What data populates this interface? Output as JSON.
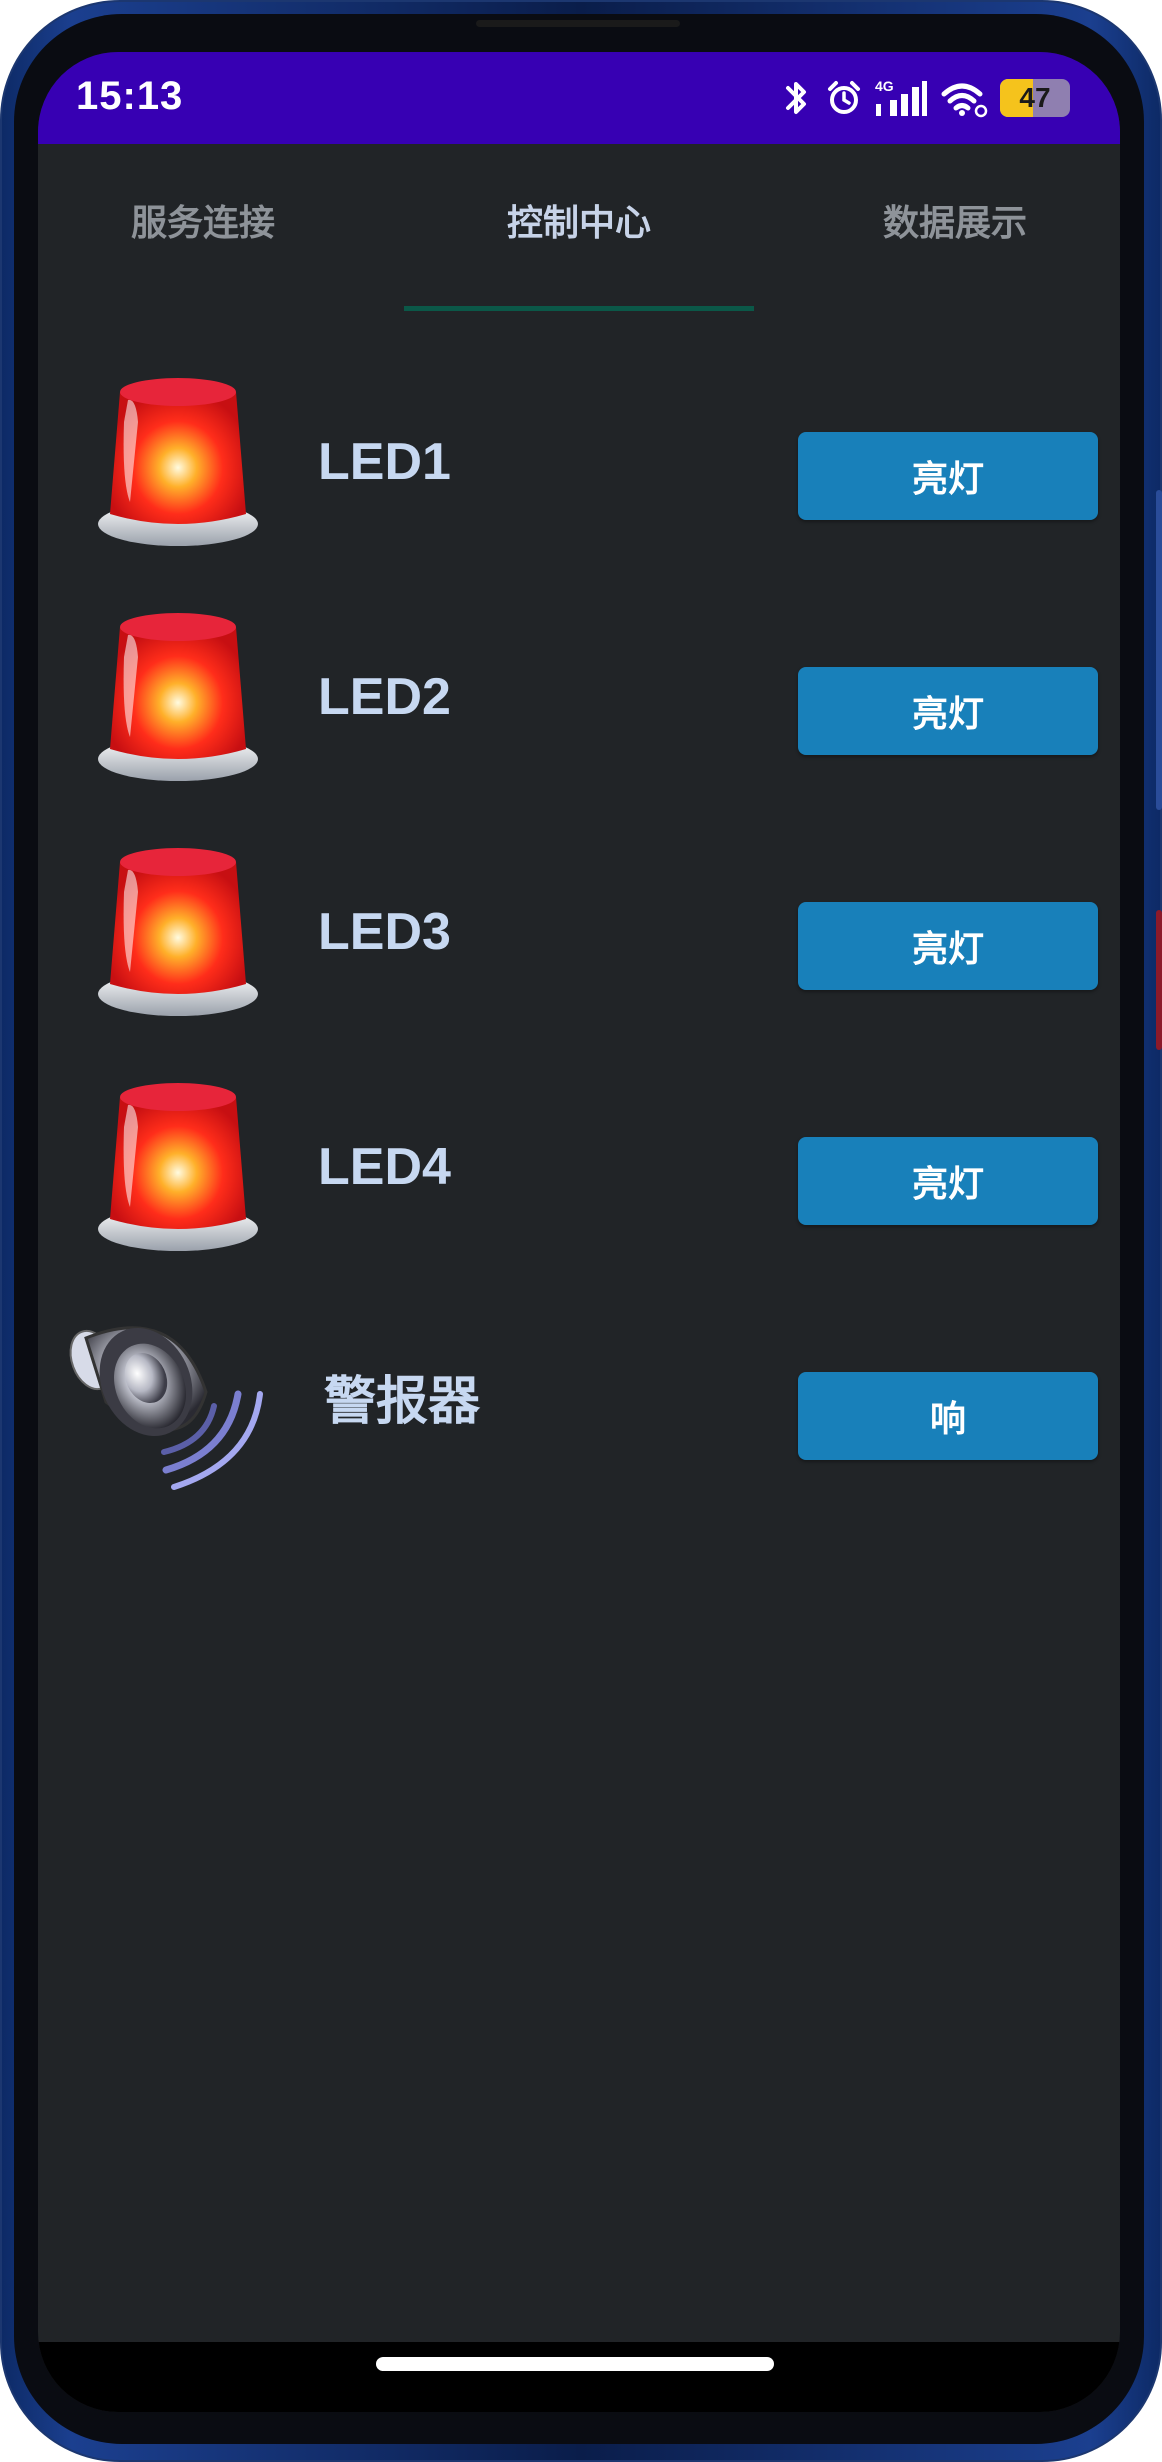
{
  "status_bar": {
    "time": "15:13",
    "network_label": "4G",
    "battery_level": "47",
    "background_color": "#3700b3",
    "icons": [
      "bluetooth-icon",
      "alarm-icon",
      "signal-4g-icon",
      "wifi-icon",
      "battery-icon"
    ]
  },
  "tabs": [
    {
      "label": "服务连接",
      "active": false
    },
    {
      "label": "控制中心",
      "active": true
    },
    {
      "label": "数据展示",
      "active": false
    }
  ],
  "devices": [
    {
      "name": "LED1",
      "icon": "red-beacon-icon",
      "button_label": "亮灯"
    },
    {
      "name": "LED2",
      "icon": "red-beacon-icon",
      "button_label": "亮灯"
    },
    {
      "name": "LED3",
      "icon": "red-beacon-icon",
      "button_label": "亮灯"
    },
    {
      "name": "LED4",
      "icon": "red-beacon-icon",
      "button_label": "亮灯"
    },
    {
      "name": "警报器",
      "icon": "speaker-icon",
      "button_label": "响"
    }
  ],
  "colors": {
    "accent_button": "#1880ba",
    "tab_indicator": "#0b5848",
    "screen_background": "#212427",
    "device_label": "#c7d8f1"
  }
}
